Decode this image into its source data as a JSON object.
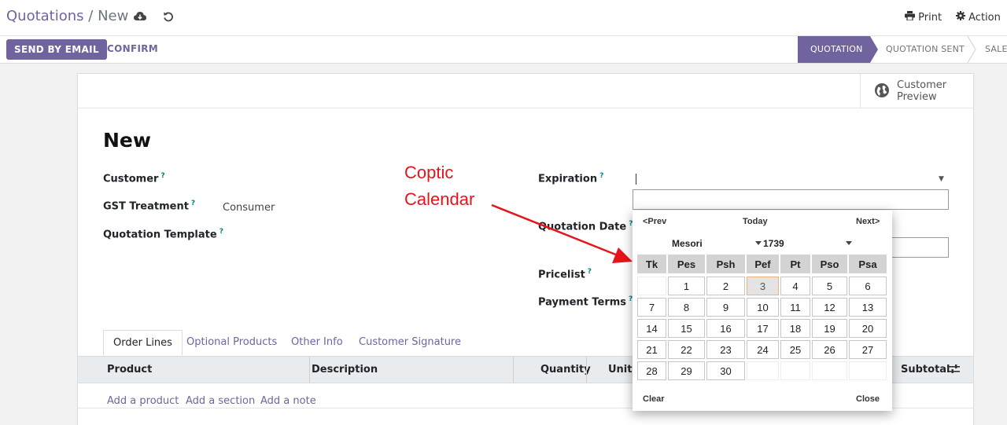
{
  "breadcrumb": {
    "parent": "Quotations",
    "separator": "/",
    "current": "New"
  },
  "topbar": {
    "print_label": "Print",
    "action_label": "Action"
  },
  "statusbar": {
    "send_email_label": "SEND BY EMAIL",
    "confirm_label": "CONFIRM",
    "stages": [
      "QUOTATION",
      "QUOTATION SENT",
      "SALE"
    ],
    "active_stage": "QUOTATION"
  },
  "sheet": {
    "customer_preview_label": "Customer Preview",
    "title": "New",
    "fields": {
      "customer_label": "Customer",
      "gst_label": "GST Treatment",
      "gst_value": "Consumer",
      "template_label": "Quotation Template",
      "expiration_label": "Expiration",
      "quotation_date_label": "Quotation Date",
      "pricelist_label": "Pricelist",
      "payment_terms_label": "Payment Terms",
      "help_marker": "?"
    },
    "tabs": [
      "Order Lines",
      "Optional Products",
      "Other Info",
      "Customer Signature"
    ],
    "table_headers": [
      "Product",
      "Description",
      "Quantity",
      "Unit P",
      "Subtotal"
    ],
    "add_links": [
      "Add a product",
      "Add a section",
      "Add a note"
    ]
  },
  "annotation": {
    "line1": "Coptic",
    "line2": "Calendar",
    "color": "#e8141c"
  },
  "datepicker": {
    "prev_label": "<Prev",
    "today_label": "Today",
    "next_label": "Next>",
    "month": "Mesori",
    "year": "1739",
    "weekdays": [
      "Tk",
      "Pes",
      "Psh",
      "Pef",
      "Pt",
      "Pso",
      "Psa"
    ],
    "weeks": [
      [
        "",
        "1",
        "2",
        "3",
        "4",
        "5",
        "6"
      ],
      [
        "7",
        "8",
        "9",
        "10",
        "11",
        "12",
        "13"
      ],
      [
        "14",
        "15",
        "16",
        "17",
        "18",
        "19",
        "20"
      ],
      [
        "21",
        "22",
        "23",
        "24",
        "25",
        "26",
        "27"
      ],
      [
        "28",
        "29",
        "30",
        "",
        "",
        "",
        ""
      ]
    ],
    "highlighted_day": "3",
    "clear_label": "Clear",
    "close_label": "Close"
  },
  "colors": {
    "brand": "#71639e",
    "help": "#017e84",
    "today_border": "#f0b27a"
  }
}
